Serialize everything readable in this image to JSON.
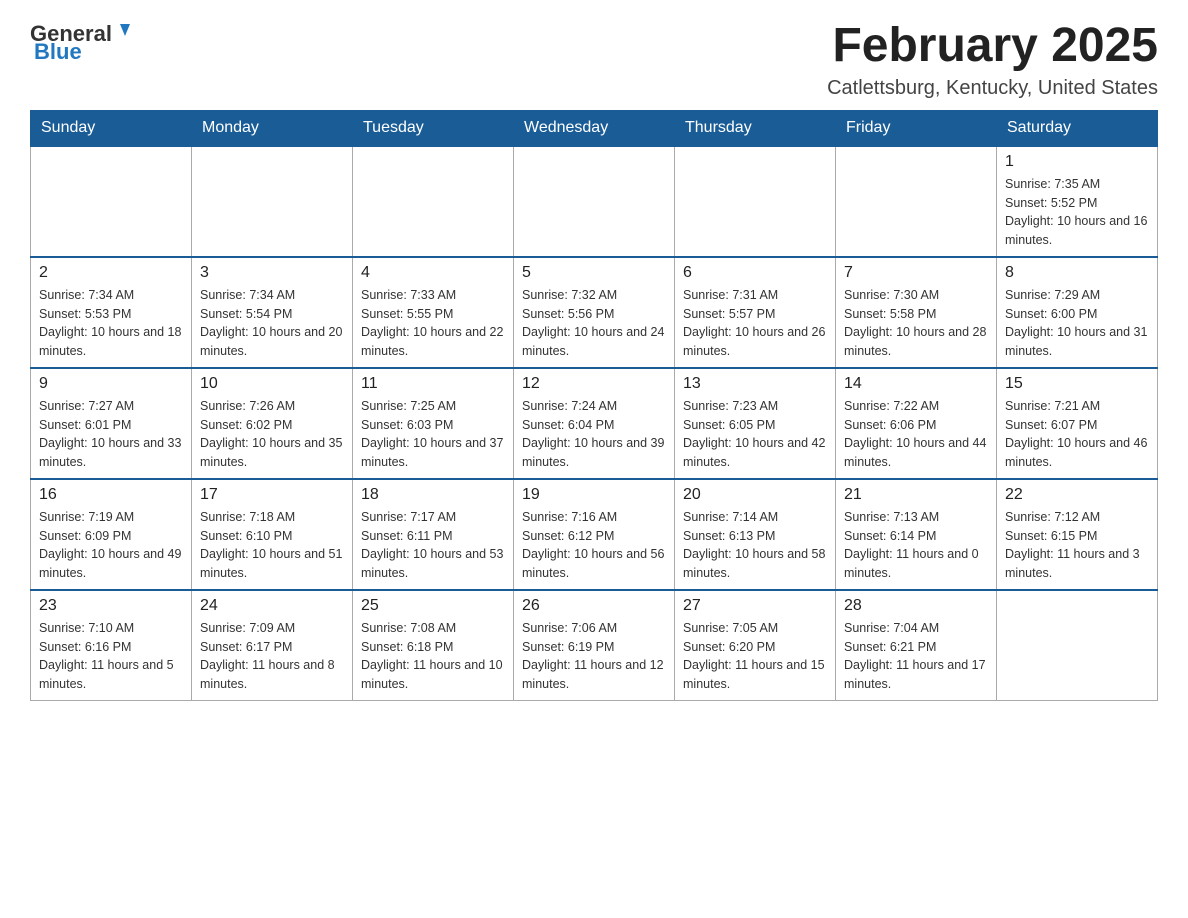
{
  "header": {
    "logo": {
      "text_general": "General",
      "text_blue": "Blue"
    },
    "title": "February 2025",
    "location": "Catlettsburg, Kentucky, United States"
  },
  "weekdays": [
    "Sunday",
    "Monday",
    "Tuesday",
    "Wednesday",
    "Thursday",
    "Friday",
    "Saturday"
  ],
  "weeks": [
    [
      {
        "day": "",
        "sunrise": "",
        "sunset": "",
        "daylight": ""
      },
      {
        "day": "",
        "sunrise": "",
        "sunset": "",
        "daylight": ""
      },
      {
        "day": "",
        "sunrise": "",
        "sunset": "",
        "daylight": ""
      },
      {
        "day": "",
        "sunrise": "",
        "sunset": "",
        "daylight": ""
      },
      {
        "day": "",
        "sunrise": "",
        "sunset": "",
        "daylight": ""
      },
      {
        "day": "",
        "sunrise": "",
        "sunset": "",
        "daylight": ""
      },
      {
        "day": "1",
        "sunrise": "Sunrise: 7:35 AM",
        "sunset": "Sunset: 5:52 PM",
        "daylight": "Daylight: 10 hours and 16 minutes."
      }
    ],
    [
      {
        "day": "2",
        "sunrise": "Sunrise: 7:34 AM",
        "sunset": "Sunset: 5:53 PM",
        "daylight": "Daylight: 10 hours and 18 minutes."
      },
      {
        "day": "3",
        "sunrise": "Sunrise: 7:34 AM",
        "sunset": "Sunset: 5:54 PM",
        "daylight": "Daylight: 10 hours and 20 minutes."
      },
      {
        "day": "4",
        "sunrise": "Sunrise: 7:33 AM",
        "sunset": "Sunset: 5:55 PM",
        "daylight": "Daylight: 10 hours and 22 minutes."
      },
      {
        "day": "5",
        "sunrise": "Sunrise: 7:32 AM",
        "sunset": "Sunset: 5:56 PM",
        "daylight": "Daylight: 10 hours and 24 minutes."
      },
      {
        "day": "6",
        "sunrise": "Sunrise: 7:31 AM",
        "sunset": "Sunset: 5:57 PM",
        "daylight": "Daylight: 10 hours and 26 minutes."
      },
      {
        "day": "7",
        "sunrise": "Sunrise: 7:30 AM",
        "sunset": "Sunset: 5:58 PM",
        "daylight": "Daylight: 10 hours and 28 minutes."
      },
      {
        "day": "8",
        "sunrise": "Sunrise: 7:29 AM",
        "sunset": "Sunset: 6:00 PM",
        "daylight": "Daylight: 10 hours and 31 minutes."
      }
    ],
    [
      {
        "day": "9",
        "sunrise": "Sunrise: 7:27 AM",
        "sunset": "Sunset: 6:01 PM",
        "daylight": "Daylight: 10 hours and 33 minutes."
      },
      {
        "day": "10",
        "sunrise": "Sunrise: 7:26 AM",
        "sunset": "Sunset: 6:02 PM",
        "daylight": "Daylight: 10 hours and 35 minutes."
      },
      {
        "day": "11",
        "sunrise": "Sunrise: 7:25 AM",
        "sunset": "Sunset: 6:03 PM",
        "daylight": "Daylight: 10 hours and 37 minutes."
      },
      {
        "day": "12",
        "sunrise": "Sunrise: 7:24 AM",
        "sunset": "Sunset: 6:04 PM",
        "daylight": "Daylight: 10 hours and 39 minutes."
      },
      {
        "day": "13",
        "sunrise": "Sunrise: 7:23 AM",
        "sunset": "Sunset: 6:05 PM",
        "daylight": "Daylight: 10 hours and 42 minutes."
      },
      {
        "day": "14",
        "sunrise": "Sunrise: 7:22 AM",
        "sunset": "Sunset: 6:06 PM",
        "daylight": "Daylight: 10 hours and 44 minutes."
      },
      {
        "day": "15",
        "sunrise": "Sunrise: 7:21 AM",
        "sunset": "Sunset: 6:07 PM",
        "daylight": "Daylight: 10 hours and 46 minutes."
      }
    ],
    [
      {
        "day": "16",
        "sunrise": "Sunrise: 7:19 AM",
        "sunset": "Sunset: 6:09 PM",
        "daylight": "Daylight: 10 hours and 49 minutes."
      },
      {
        "day": "17",
        "sunrise": "Sunrise: 7:18 AM",
        "sunset": "Sunset: 6:10 PM",
        "daylight": "Daylight: 10 hours and 51 minutes."
      },
      {
        "day": "18",
        "sunrise": "Sunrise: 7:17 AM",
        "sunset": "Sunset: 6:11 PM",
        "daylight": "Daylight: 10 hours and 53 minutes."
      },
      {
        "day": "19",
        "sunrise": "Sunrise: 7:16 AM",
        "sunset": "Sunset: 6:12 PM",
        "daylight": "Daylight: 10 hours and 56 minutes."
      },
      {
        "day": "20",
        "sunrise": "Sunrise: 7:14 AM",
        "sunset": "Sunset: 6:13 PM",
        "daylight": "Daylight: 10 hours and 58 minutes."
      },
      {
        "day": "21",
        "sunrise": "Sunrise: 7:13 AM",
        "sunset": "Sunset: 6:14 PM",
        "daylight": "Daylight: 11 hours and 0 minutes."
      },
      {
        "day": "22",
        "sunrise": "Sunrise: 7:12 AM",
        "sunset": "Sunset: 6:15 PM",
        "daylight": "Daylight: 11 hours and 3 minutes."
      }
    ],
    [
      {
        "day": "23",
        "sunrise": "Sunrise: 7:10 AM",
        "sunset": "Sunset: 6:16 PM",
        "daylight": "Daylight: 11 hours and 5 minutes."
      },
      {
        "day": "24",
        "sunrise": "Sunrise: 7:09 AM",
        "sunset": "Sunset: 6:17 PM",
        "daylight": "Daylight: 11 hours and 8 minutes."
      },
      {
        "day": "25",
        "sunrise": "Sunrise: 7:08 AM",
        "sunset": "Sunset: 6:18 PM",
        "daylight": "Daylight: 11 hours and 10 minutes."
      },
      {
        "day": "26",
        "sunrise": "Sunrise: 7:06 AM",
        "sunset": "Sunset: 6:19 PM",
        "daylight": "Daylight: 11 hours and 12 minutes."
      },
      {
        "day": "27",
        "sunrise": "Sunrise: 7:05 AM",
        "sunset": "Sunset: 6:20 PM",
        "daylight": "Daylight: 11 hours and 15 minutes."
      },
      {
        "day": "28",
        "sunrise": "Sunrise: 7:04 AM",
        "sunset": "Sunset: 6:21 PM",
        "daylight": "Daylight: 11 hours and 17 minutes."
      },
      {
        "day": "",
        "sunrise": "",
        "sunset": "",
        "daylight": ""
      }
    ]
  ]
}
